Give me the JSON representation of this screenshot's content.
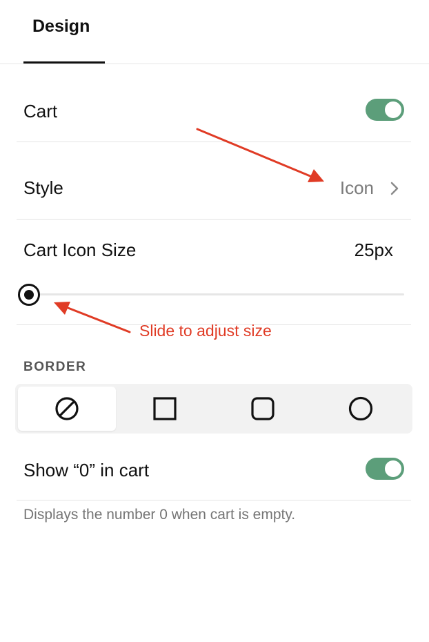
{
  "tabs": [
    {
      "label": "Design",
      "active": true
    }
  ],
  "cart": {
    "label": "Cart",
    "enabled": true
  },
  "style": {
    "label": "Style",
    "value": "Icon"
  },
  "icon_size": {
    "label": "Cart Icon Size",
    "value": "25px",
    "slider_fraction": 0.0
  },
  "annotations": {
    "slider_hint": "Slide to adjust size",
    "color": "#e03b25"
  },
  "border": {
    "section_label": "BORDER",
    "options": [
      {
        "icon": "none-icon",
        "selected": true
      },
      {
        "icon": "square-icon",
        "selected": false
      },
      {
        "icon": "rounded-square-icon",
        "selected": false
      },
      {
        "icon": "circle-icon",
        "selected": false
      }
    ]
  },
  "show_zero": {
    "label": "Show “0” in cart",
    "enabled": true,
    "helper": "Displays the number 0 when cart is empty."
  },
  "colors": {
    "toggle_on": "#5c9e7a",
    "text": "#111111",
    "muted": "#7a7a7a"
  }
}
